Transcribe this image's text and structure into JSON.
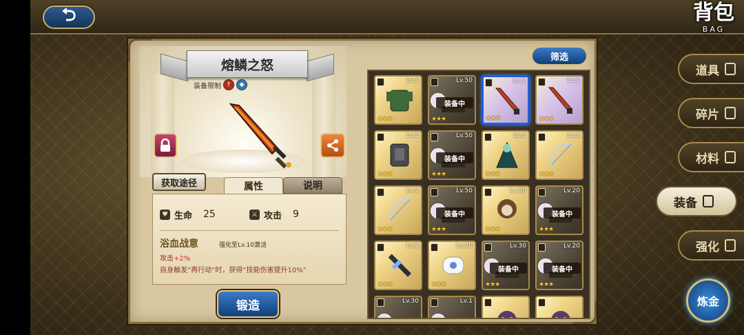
{
  "header": {
    "title_cn": "背包",
    "title_en": "BAG",
    "back_label": "⮌"
  },
  "item": {
    "name": "熔鳞之怒",
    "restriction_label": "装备限制",
    "acquire_label": "获取途径",
    "tabs": [
      "属性",
      "说明"
    ],
    "stats": [
      {
        "icon": "heart-icon",
        "label": "生命",
        "value": "25"
      },
      {
        "icon": "sword-icon",
        "label": "攻击",
        "value": "9"
      }
    ],
    "skill": {
      "name": "浴血战意",
      "condition": "强化至Lv.10激活",
      "line1_prefix": "攻击",
      "line1_value": "+2%",
      "line2": "自身触发“再行动”时，获得“技能伤害提升10%”"
    },
    "forge_label": "锻造"
  },
  "filter_label": "筛选",
  "grid_items": [
    {
      "lv": "Lv.1",
      "equipped": false,
      "style": "gold",
      "stars": "★★★",
      "art": "armor-green"
    },
    {
      "lv": "Lv.50",
      "equipped": true,
      "style": "dark",
      "stars": "★★★",
      "art": "dark"
    },
    {
      "lv": "Lv.1",
      "equipped": false,
      "style": "purple",
      "stars": "★★★",
      "art": "sword",
      "selected": true
    },
    {
      "lv": "Lv.1",
      "equipped": false,
      "style": "purple",
      "stars": "★★★",
      "art": "sword"
    },
    {
      "lv": "Lv.1",
      "equipped": false,
      "style": "gold",
      "stars": "★★★",
      "art": "armor-grey"
    },
    {
      "lv": "Lv.50",
      "equipped": true,
      "style": "dark",
      "stars": "★★★",
      "art": "dark"
    },
    {
      "lv": "Lv.1",
      "equipped": false,
      "style": "gold",
      "stars": "★★★",
      "art": "cloak"
    },
    {
      "lv": "Lv.1",
      "equipped": false,
      "style": "gold",
      "stars": "★★★",
      "art": "bow"
    },
    {
      "lv": "Lv.1",
      "equipped": false,
      "style": "gold",
      "stars": "★★★",
      "art": "bow"
    },
    {
      "lv": "Lv.50",
      "equipped": true,
      "style": "dark",
      "stars": "★★★",
      "art": "dark"
    },
    {
      "lv": "Lv.30",
      "equipped": false,
      "style": "gold",
      "stars": "★★★",
      "art": "beast"
    },
    {
      "lv": "Lv.20",
      "equipped": true,
      "style": "dark",
      "stars": "★★★",
      "art": "dark"
    },
    {
      "lv": "Lv.1",
      "equipped": false,
      "style": "gold",
      "stars": "★★★",
      "art": "gun"
    },
    {
      "lv": "Lv.20",
      "equipped": false,
      "style": "gold",
      "stars": "★★★",
      "art": "hat"
    },
    {
      "lv": "Lv.30",
      "equipped": true,
      "style": "dark",
      "stars": "★★★",
      "art": "dark"
    },
    {
      "lv": "Lv.20",
      "equipped": true,
      "style": "dark",
      "stars": "★★★",
      "art": "dark"
    },
    {
      "lv": "Lv.30",
      "equipped": true,
      "style": "dark",
      "stars": "★★★",
      "art": "dark"
    },
    {
      "lv": "Lv.1",
      "equipped": true,
      "style": "dark",
      "stars": "★★★",
      "art": "dark"
    },
    {
      "lv": "",
      "equipped": false,
      "style": "gold",
      "stars": "",
      "art": "mask"
    },
    {
      "lv": "",
      "equipped": false,
      "style": "gold",
      "stars": "",
      "art": "mask"
    }
  ],
  "equipped_label": "装备中",
  "side_tabs": [
    {
      "label": "道具",
      "icon": "flask-icon"
    },
    {
      "label": "碎片",
      "icon": "shard-icon"
    },
    {
      "label": "材料",
      "icon": "material-icon"
    },
    {
      "label": "装备",
      "icon": "equipment-icon",
      "active": true
    },
    {
      "label": "强化",
      "icon": "enhance-icon"
    }
  ],
  "alchemy_label": "炼金",
  "colors": {
    "accent_blue": "#1e5de0",
    "gold": "#d9bd72"
  }
}
